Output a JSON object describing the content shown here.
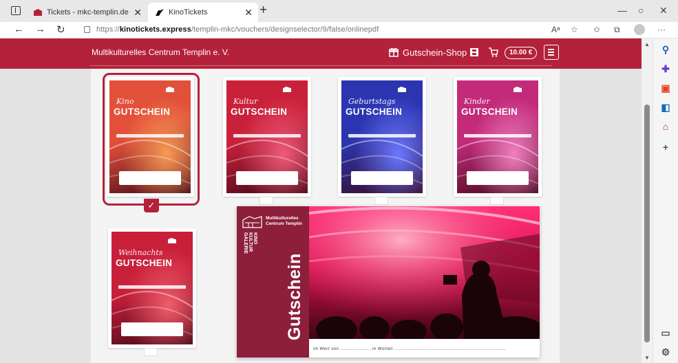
{
  "browser": {
    "tabs": [
      {
        "title": "Tickets - mkc-templin.de",
        "active": false
      },
      {
        "title": "KinoTickets",
        "active": true
      }
    ],
    "url_prefix": "https://",
    "url_domain": "kinotickets.express",
    "url_path": "/templin-mkc/vouchers/designselector/9/false/onlinepdf",
    "reader_label": "Aᵃ",
    "icons": [
      "back-icon",
      "forward-icon",
      "refresh-icon",
      "lock-icon",
      "read-aloud-icon",
      "favorite-add-icon",
      "favorites-icon",
      "collections-icon",
      "profile-icon",
      "more-icon"
    ]
  },
  "site": {
    "brand": "Multikulturelles Centrum Templin e. V.",
    "shop_link": "Gutschein-Shop",
    "cart_total": "10.00 €",
    "header_color": "#b4213a"
  },
  "vouchers": [
    {
      "word1": "Kino",
      "word2": "GUTSCHEIN",
      "selected": true,
      "base": "#e2503a",
      "accent": "#f79a55"
    },
    {
      "word1": "Kultur",
      "word2": "GUTSCHEIN",
      "selected": false,
      "base": "#c9213a",
      "accent": "#ee5a7a"
    },
    {
      "word1": "Geburtstags",
      "word2": "GUTSCHEIN",
      "selected": false,
      "base": "#2c35b0",
      "accent": "#6a78ff"
    },
    {
      "word1": "Kinder",
      "word2": "GUTSCHEIN",
      "selected": false,
      "base": "#c22a7a",
      "accent": "#f080c0"
    },
    {
      "word1": "Weihnachts",
      "word2": "GUTSCHEIN",
      "selected": false,
      "base": "#c81f3a",
      "accent": "#f25c6a"
    }
  ],
  "preview": {
    "org_line1": "Multikulturelles",
    "org_line2": "Centrum Templin",
    "kino_lines": [
      "KINO",
      "KULTUR",
      "GALERIE"
    ],
    "title": "Gutschein",
    "footer_value_label": "im Wert von",
    "footer_words_label": "in Worten",
    "bg_color": "#8d1f3a"
  },
  "check_glyph": "✓"
}
